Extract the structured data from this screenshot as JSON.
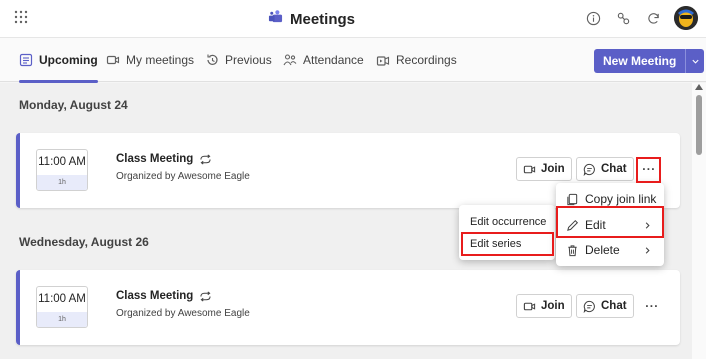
{
  "app": {
    "title": "Meetings"
  },
  "tabs": [
    {
      "label": "Upcoming",
      "icon": "calendar-list-icon",
      "active": true
    },
    {
      "label": "My meetings",
      "icon": "video-icon"
    },
    {
      "label": "Previous",
      "icon": "history-icon"
    },
    {
      "label": "Attendance",
      "icon": "people-icon"
    },
    {
      "label": "Recordings",
      "icon": "recording-icon"
    }
  ],
  "new_meeting": {
    "label": "New Meeting"
  },
  "days": [
    {
      "label": "Monday, August 24",
      "meeting": {
        "time": "11:00 AM",
        "duration": "1h",
        "title": "Class Meeting",
        "organizer": "Organized by Awesome Eagle"
      }
    },
    {
      "label": "Wednesday, August 26",
      "meeting": {
        "time": "11:00 AM",
        "duration": "1h",
        "title": "Class Meeting",
        "organizer": "Organized by Awesome Eagle"
      }
    }
  ],
  "buttons": {
    "join": "Join",
    "chat": "Chat",
    "more": "···"
  },
  "context_menu": {
    "items": [
      {
        "label": "Copy join link",
        "icon": "copy-icon"
      },
      {
        "label": "Edit",
        "icon": "pencil-icon"
      },
      {
        "label": "Delete",
        "icon": "trash-icon"
      }
    ]
  },
  "edit_submenu": {
    "items": [
      {
        "label": "Edit occurrence"
      },
      {
        "label": "Edit series"
      }
    ]
  },
  "colors": {
    "accent": "#5b5fc7",
    "highlight": "#e81c1c"
  }
}
